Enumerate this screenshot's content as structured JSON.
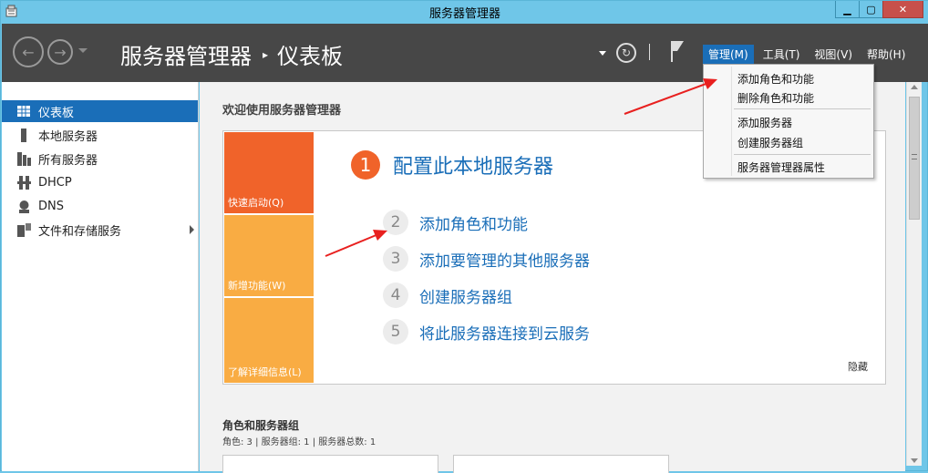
{
  "window": {
    "title": "服务器管理器",
    "controls": {
      "minimize": "▁",
      "maximize": "▢",
      "close": "✕"
    }
  },
  "header": {
    "breadcrumb_root": "服务器管理器",
    "breadcrumb_sep": "▸",
    "breadcrumb_current": "仪表板",
    "menus": [
      {
        "label": "管理(M)",
        "active": true
      },
      {
        "label": "工具(T)"
      },
      {
        "label": "视图(V)"
      },
      {
        "label": "帮助(H)"
      }
    ]
  },
  "sidebar": {
    "items": [
      {
        "label": "仪表板",
        "icon": "dashboard-icon",
        "selected": true
      },
      {
        "label": "本地服务器",
        "icon": "server-icon"
      },
      {
        "label": "所有服务器",
        "icon": "servers-icon"
      },
      {
        "label": "DHCP",
        "icon": "dhcp-icon"
      },
      {
        "label": "DNS",
        "icon": "dns-icon"
      },
      {
        "label": "文件和存储服务",
        "icon": "storage-icon",
        "expandable": true
      }
    ]
  },
  "main": {
    "welcome_title": "欢迎使用服务器管理器",
    "tiles": {
      "quick_start": "快速启动(Q)",
      "whats_new": "新增功能(W)",
      "learn_more": "了解详细信息(L)"
    },
    "steps": [
      {
        "num": "1",
        "label": "配置此本地服务器"
      },
      {
        "num": "2",
        "label": "添加角色和功能"
      },
      {
        "num": "3",
        "label": "添加要管理的其他服务器"
      },
      {
        "num": "4",
        "label": "创建服务器组"
      },
      {
        "num": "5",
        "label": "将此服务器连接到云服务"
      }
    ],
    "hide_link": "隐藏",
    "roles_title": "角色和服务器组",
    "roles_summary": "角色: 3 | 服务器组: 1 | 服务器总数: 1"
  },
  "manage_menu": {
    "items": [
      "添加角色和功能",
      "删除角色和功能",
      "添加服务器",
      "创建服务器组",
      "服务器管理器属性"
    ]
  },
  "colors": {
    "accent": "#1a6eb8",
    "header": "#474747",
    "quick_start": "#f0632a",
    "tile": "#f9ac43",
    "annotation_arrow": "#e8201f"
  }
}
